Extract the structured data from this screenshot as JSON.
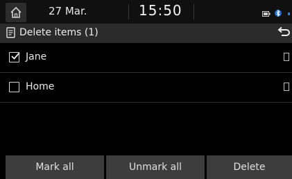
{
  "status_bar": {
    "date": "27 Mar.",
    "time": "15:50",
    "home_icon": "home-icon"
  },
  "title_bar": {
    "title": "Delete items (1)",
    "list_icon": "list-icon",
    "back_icon": "back-arrow-icon"
  },
  "list": {
    "items": [
      {
        "label": "Jane",
        "checked": true
      },
      {
        "label": "Home",
        "checked": false
      }
    ]
  },
  "buttons": {
    "mark_all": "Mark all",
    "unmark_all": "Unmark all",
    "delete": "Delete"
  }
}
